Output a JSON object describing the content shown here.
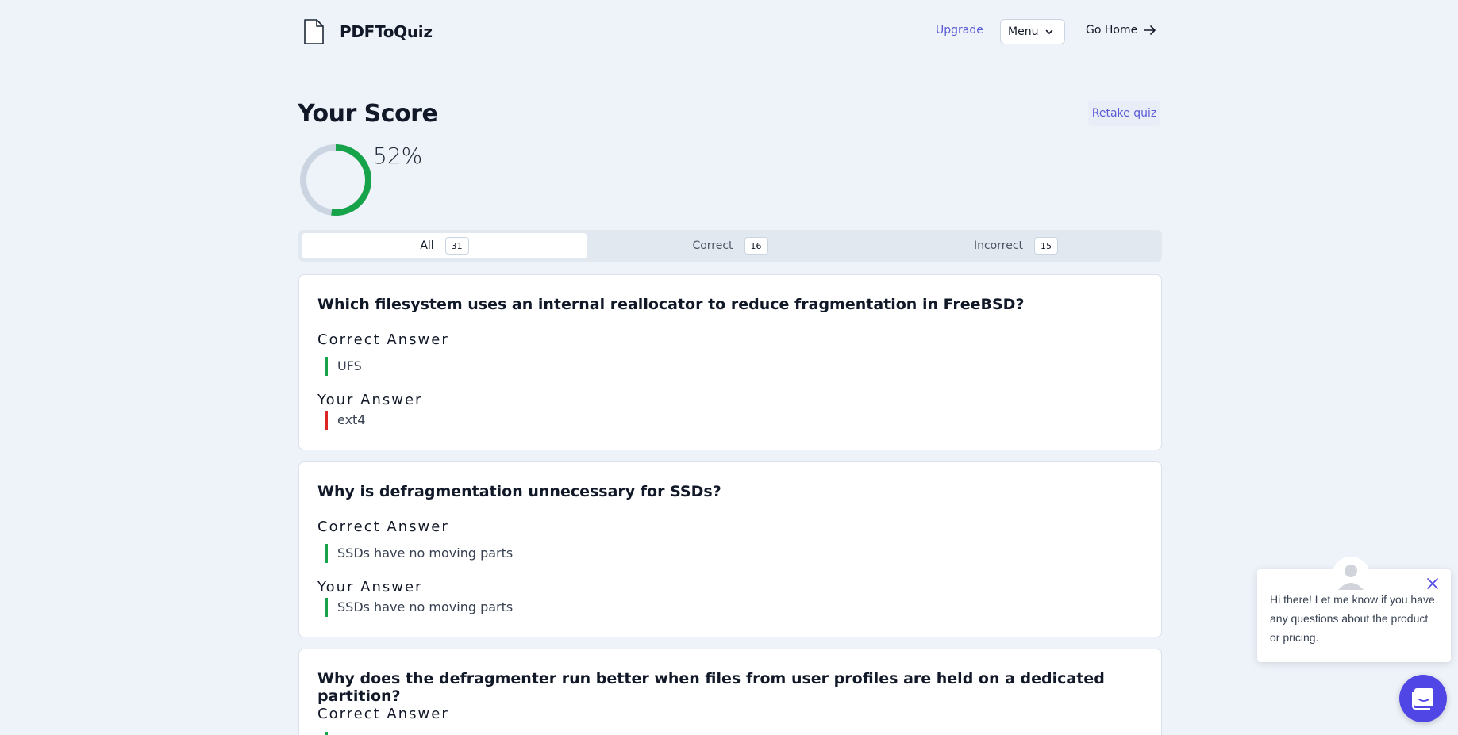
{
  "header": {
    "brand": "PDFToQuiz",
    "upgrade": "Upgrade",
    "menu": "Menu",
    "go_home": "Go Home"
  },
  "score": {
    "title": "Your Score",
    "percent_label": "52%",
    "percent_value": 52,
    "retake": "Retake quiz"
  },
  "tabs": [
    {
      "label": "All",
      "count": "31"
    },
    {
      "label": "Correct",
      "count": "16"
    },
    {
      "label": "Incorrect",
      "count": "15"
    }
  ],
  "questions": [
    {
      "question": "Which filesystem uses an internal reallocator to reduce fragmentation in FreeBSD?",
      "correct_label": "Correct Answer",
      "correct": "UFS",
      "your_label": "Your Answer",
      "yours": "ext4"
    },
    {
      "question": "Why is defragmentation unnecessary for SSDs?",
      "correct_label": "Correct Answer",
      "correct": "SSDs have no moving parts",
      "your_label": "Your Answer",
      "yours": "SSDs have no moving parts"
    },
    {
      "question": "Why does the defragmenter run better when files from user profiles are held on a dedicated partition?",
      "correct_label": "Correct Answer"
    }
  ],
  "chat": {
    "message": "Hi there! Let me know if you have any questions about the product or pricing."
  },
  "colors": {
    "accent": "#5b5bd6",
    "correct": "#16a34a",
    "incorrect": "#dc2626",
    "chat": "#4f46e5"
  }
}
